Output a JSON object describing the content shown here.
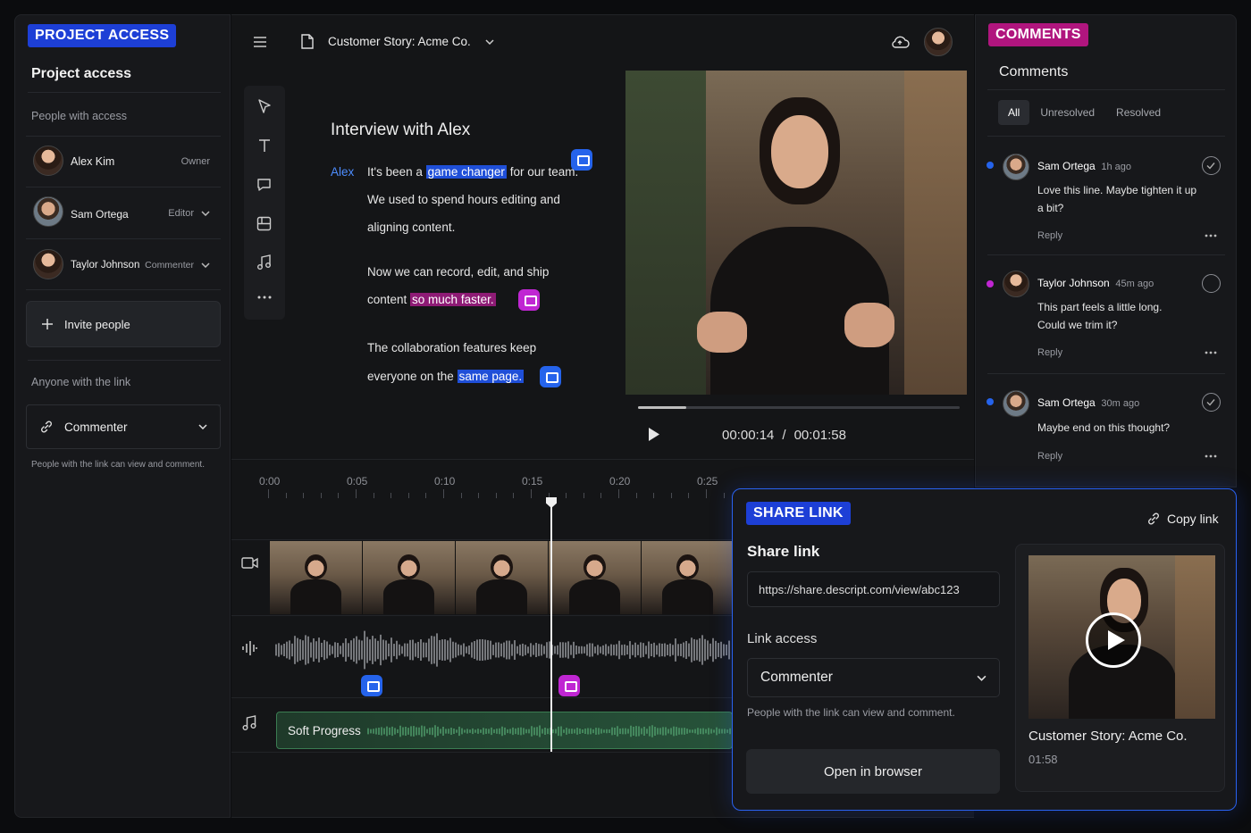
{
  "left_panel": {
    "tag": "PROJECT ACCESS",
    "title": "Project access",
    "people_header": "People with access",
    "people": [
      {
        "name": "Alex Kim",
        "role": "Owner",
        "has_dropdown": false
      },
      {
        "name": "Sam Ortega",
        "role": "Editor",
        "has_dropdown": true
      },
      {
        "name": "Taylor Johnson",
        "role": "Commenter",
        "has_dropdown": true
      }
    ],
    "invite_label": "Invite people",
    "link_header": "Anyone with the link",
    "link_role": "Commenter",
    "link_note": "People with the link can view and comment."
  },
  "topbar": {
    "doc_title": "Customer Story: Acme Co."
  },
  "transcript": {
    "title": "Interview with Alex",
    "speaker": "Alex",
    "p1_pre": "It's been a ",
    "p1_hl": "game changer",
    "p1_post": " for our team.",
    "p1_line2": "We used to spend hours editing and",
    "p1_line3": "aligning content.",
    "p2_line1": "Now we can record, edit, and ship",
    "p2_pre": "content ",
    "p2_hl": "so much faster.",
    "p3_line1": "The collaboration features keep",
    "p3_pre": "everyone on the ",
    "p3_hl": "same page."
  },
  "player": {
    "current_time": "00:00:14",
    "separator": "/",
    "duration": "00:01:58",
    "progress": 0.15
  },
  "timeline": {
    "ticks": [
      "0:00",
      "0:05",
      "0:10",
      "0:15",
      "0:20",
      "0:25"
    ],
    "music_track": "Soft Progress"
  },
  "comments": {
    "tag": "COMMENTS",
    "title": "Comments",
    "tabs": [
      "All",
      "Unresolved",
      "Resolved"
    ],
    "active_tab": "All",
    "items": [
      {
        "author": "Sam Ortega",
        "time": "1h ago",
        "line1": "Love this line. Maybe tighten it up",
        "line2": "a bit?",
        "reply": "Reply",
        "dot": "#2563eb",
        "resolved": true
      },
      {
        "author": "Taylor Johnson",
        "time": "45m ago",
        "line1": "This part feels a little long.",
        "line2": "Could we trim it?",
        "reply": "Reply",
        "dot": "#c026d3",
        "resolved": false
      },
      {
        "author": "Sam Ortega",
        "time": "30m ago",
        "line1": "Maybe end on this thought?",
        "line2": "",
        "reply": "Reply",
        "dot": "#2563eb",
        "resolved": true
      }
    ]
  },
  "share": {
    "tag": "SHARE LINK",
    "title": "Share link",
    "copy_label": "Copy link",
    "url": "https://share.descript.com/view/abc123",
    "access_label": "Link access",
    "access_value": "Commenter",
    "note": "People with the link can view and comment.",
    "open_label": "Open in browser",
    "preview_title": "Customer Story: Acme Co.",
    "preview_duration": "01:58"
  }
}
